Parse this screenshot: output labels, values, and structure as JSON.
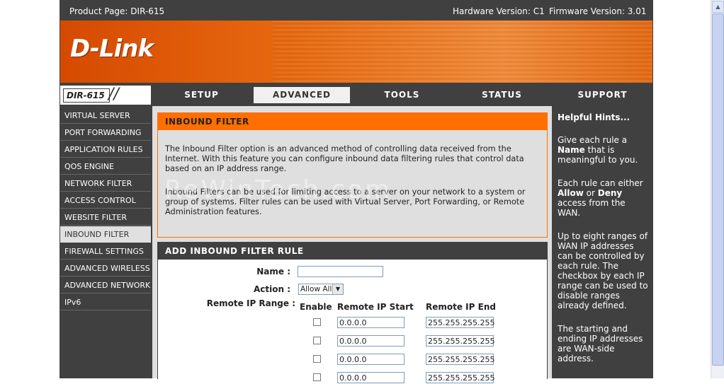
{
  "topbar": {
    "product": "Product Page: DIR-615",
    "hardware": "Hardware Version: C1",
    "firmware": "Firmware Version: 3.01"
  },
  "logo": "D-Link",
  "model_tag": "DIR-615",
  "tabs": [
    {
      "label": "SETUP"
    },
    {
      "label": "ADVANCED"
    },
    {
      "label": "TOOLS"
    },
    {
      "label": "STATUS"
    },
    {
      "label": "SUPPORT"
    }
  ],
  "sidebar": {
    "items": [
      {
        "label": "VIRTUAL SERVER"
      },
      {
        "label": "PORT FORWARDING"
      },
      {
        "label": "APPLICATION RULES"
      },
      {
        "label": "QOS ENGINE"
      },
      {
        "label": "NETWORK FILTER"
      },
      {
        "label": "ACCESS CONTROL"
      },
      {
        "label": "WEBSITE FILTER"
      },
      {
        "label": "INBOUND FILTER"
      },
      {
        "label": "FIREWALL SETTINGS"
      },
      {
        "label": "ADVANCED WIRELESS"
      },
      {
        "label": "ADVANCED NETWORK"
      },
      {
        "label": "IPv6"
      }
    ]
  },
  "inbound": {
    "title": "INBOUND FILTER",
    "para1": "The Inbound Filter option is an advanced method of controlling data received from the Internet. With this feature you can configure inbound data filtering rules that control data based on an IP address range.",
    "para2": "Inbound Filters can be used for limiting access to a server on your network to a system or group of systems. Filter rules can be used with Virtual Server, Port Forwarding, or Remote Administration features."
  },
  "rule": {
    "title": "ADD INBOUND FILTER RULE",
    "name_label": "Name :",
    "name_value": "",
    "action_label": "Action :",
    "action_value": "Allow All",
    "range_label": "Remote IP Range :",
    "col_enable": "Enable",
    "col_start": "Remote IP Start",
    "col_end": "Remote IP End",
    "rows": [
      {
        "start": "0.0.0.0",
        "end": "255.255.255.255"
      },
      {
        "start": "0.0.0.0",
        "end": "255.255.255.255"
      },
      {
        "start": "0.0.0.0",
        "end": "255.255.255.255"
      },
      {
        "start": "0.0.0.0",
        "end": "255.255.255.255"
      }
    ]
  },
  "hints": {
    "title": "Helpful Hints...",
    "h1_pre": "Give each rule a ",
    "h1_bold": "Name",
    "h1_post": " that is meaningful to you.",
    "h2_pre": "Each rule can either ",
    "h2_bold1": "Allow",
    "h2_mid": " or ",
    "h2_bold2": "Deny",
    "h2_post": " access from the WAN.",
    "h3": "Up to eight ranges of WAN IP addresses can be controlled by each rule. The checkbox by each IP range can be used to disable ranges already defined.",
    "h4": "The starting and ending IP addresses are WAN-side address."
  },
  "watermark": "ReWinTech.com"
}
